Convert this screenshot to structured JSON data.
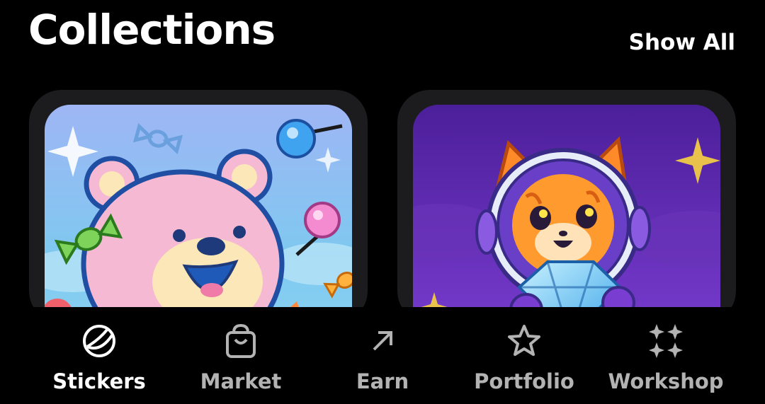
{
  "header": {
    "title": "Collections",
    "show_all_label": "Show All"
  },
  "cards": [
    {
      "icon": "pink-bear-sticker"
    },
    {
      "icon": "astronaut-fox-sticker"
    }
  ],
  "bottom_nav": {
    "items": [
      {
        "label": "Stickers",
        "icon": "sticker-icon",
        "active": true
      },
      {
        "label": "Market",
        "icon": "shopping-bag-icon",
        "active": false
      },
      {
        "label": "Earn",
        "icon": "arrow-up-right-icon",
        "active": false
      },
      {
        "label": "Portfolio",
        "icon": "star-icon",
        "active": false
      },
      {
        "label": "Workshop",
        "icon": "sparkles-icon",
        "active": false
      }
    ]
  },
  "colors": {
    "background": "#000000",
    "text_active": "#ffffff",
    "text_inactive": "#b3b3b3",
    "card_frame": "#1c1c1e"
  }
}
